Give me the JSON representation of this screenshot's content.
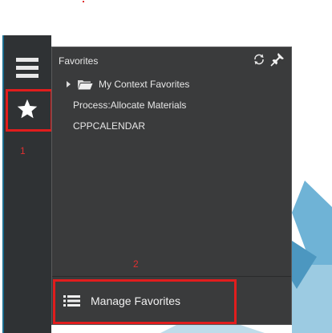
{
  "annotations": {
    "favorites_marker": "1",
    "manage_marker": "2"
  },
  "panel": {
    "title": "Favorites",
    "items": [
      {
        "label": "My Context Favorites",
        "type": "folder"
      },
      {
        "label": "Process:Allocate Materials",
        "type": "item"
      },
      {
        "label": "CPPCALENDAR",
        "type": "item"
      }
    ],
    "manage_label": "Manage Favorites"
  },
  "icons": {
    "menu": "hamburger-icon",
    "favorites": "star-icon",
    "refresh": "refresh-icon",
    "pin": "pin-icon",
    "folder": "folder-icon",
    "manage": "list-icon"
  },
  "colors": {
    "rail": "#2f3234",
    "panel": "#3a3b3c",
    "annotation": "#e11d1d",
    "accent_blue": "#5fa8cc"
  }
}
